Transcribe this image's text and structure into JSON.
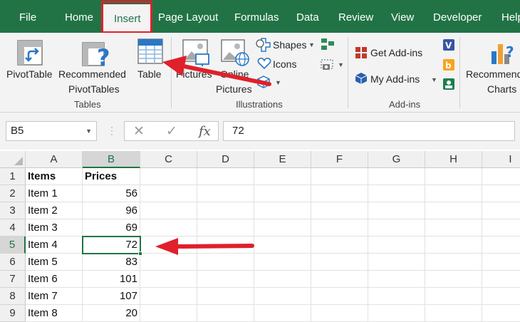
{
  "tabs": [
    {
      "label": "File"
    },
    {
      "label": "Home"
    },
    {
      "label": "Insert"
    },
    {
      "label": "Page Layout"
    },
    {
      "label": "Formulas"
    },
    {
      "label": "Data"
    },
    {
      "label": "Review"
    },
    {
      "label": "View"
    },
    {
      "label": "Developer"
    },
    {
      "label": "Help"
    }
  ],
  "ribbon": {
    "tables": {
      "group_label": "Tables",
      "pivottable": "PivotTable",
      "recommended_line1": "Recommended",
      "recommended_line2": "PivotTables",
      "table": "Table"
    },
    "illustrations": {
      "group_label": "Illustrations",
      "pictures": "Pictures",
      "online_line1": "Online",
      "online_line2": "Pictures",
      "shapes": "Shapes",
      "icons": "Icons"
    },
    "addins": {
      "group_label": "Add-ins",
      "get_addins": "Get Add-ins",
      "my_addins": "My Add-ins"
    },
    "charts": {
      "recommended_line1": "Recommended",
      "recommended_line2": "Charts"
    }
  },
  "formula_bar": {
    "name_box": "B5",
    "cancel_glyph": "✕",
    "enter_glyph": "✓",
    "fx_label": "fx",
    "value": "72"
  },
  "grid": {
    "columns": [
      "A",
      "B",
      "C",
      "D",
      "E",
      "F",
      "G",
      "H",
      "I"
    ],
    "rows": [
      "1",
      "2",
      "3",
      "4",
      "5",
      "6",
      "7",
      "8",
      "9"
    ],
    "data": [
      [
        "Items",
        "Prices"
      ],
      [
        "Item 1",
        "56"
      ],
      [
        "Item 2",
        "96"
      ],
      [
        "Item 3",
        "69"
      ],
      [
        "Item 4",
        "72"
      ],
      [
        "Item 5",
        "83"
      ],
      [
        "Item 6",
        "101"
      ],
      [
        "Item 7",
        "107"
      ],
      [
        "Item 8",
        "20"
      ]
    ],
    "selected_cell": "B5"
  },
  "colors": {
    "excel_green": "#217346",
    "annotation_red": "#e0202a"
  }
}
